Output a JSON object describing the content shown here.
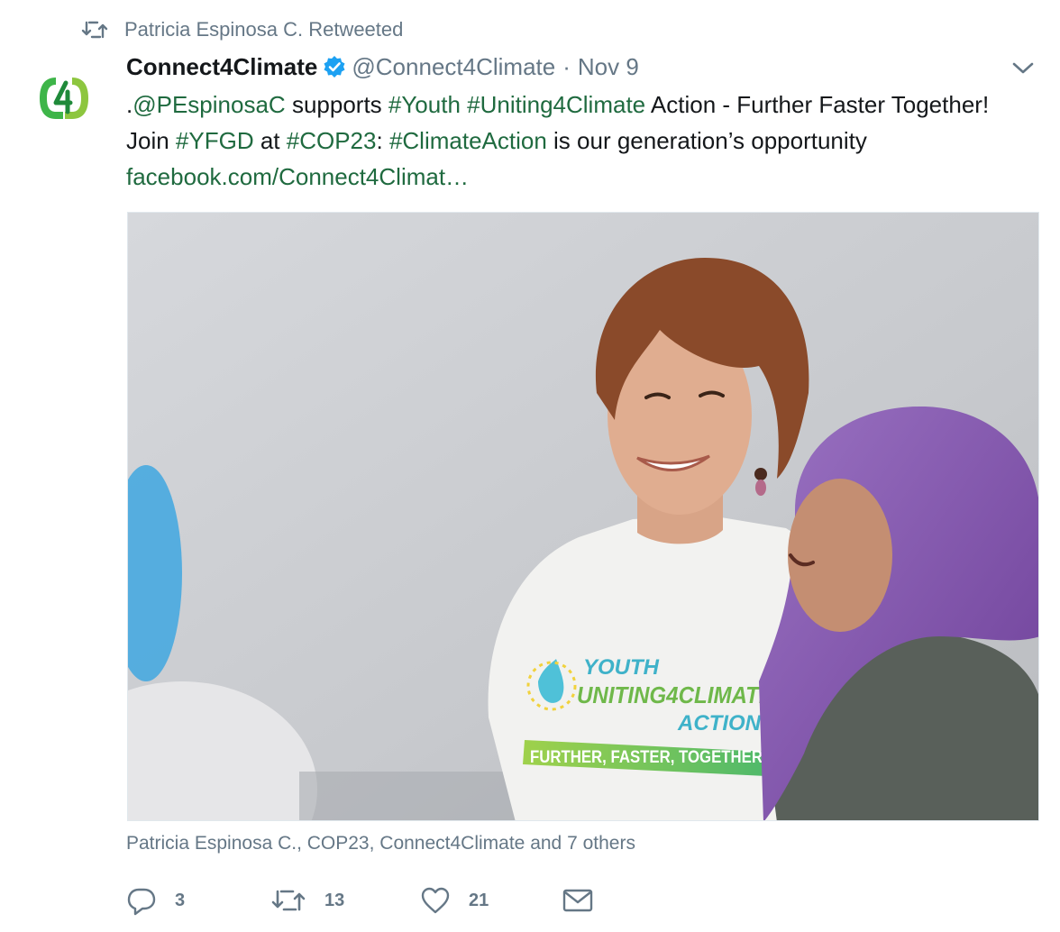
{
  "retweet_context": {
    "icon": "retweet-icon",
    "text": "Patricia Espinosa C. Retweeted"
  },
  "author": {
    "name": "Connect4Climate",
    "verified": true,
    "handle": "@Connect4Climate",
    "separator": "·",
    "date": "Nov 9",
    "avatar_icon": "connect4climate-logo",
    "brand_color": "#3eb549"
  },
  "tweet": {
    "segments": [
      {
        "text": ".",
        "link": false
      },
      {
        "text": "@PEspinosaC",
        "link": true
      },
      {
        "text": " supports ",
        "link": false
      },
      {
        "text": "#Youth",
        "link": true
      },
      {
        "text": " ",
        "link": false
      },
      {
        "text": "#Uniting4Climate",
        "link": true
      },
      {
        "text": " Action - Further Faster Together! Join ",
        "link": false
      },
      {
        "text": "#YFGD",
        "link": true
      },
      {
        "text": " at ",
        "link": false
      },
      {
        "text": "#COP23",
        "link": true
      },
      {
        "text": ": ",
        "link": false
      },
      {
        "text": "#ClimateAction",
        "link": true
      },
      {
        "text": " is our generation’s opportunity ",
        "link": false
      },
      {
        "text": "facebook.com/Connect4Climat…",
        "link": true
      }
    ],
    "link_color": "#1f6a3f"
  },
  "media": {
    "alt": "",
    "shirt_lines": [
      "YOUTH",
      "UNITING4CLIMATE",
      "ACTION",
      "FURTHER, FASTER, TOGETHER"
    ]
  },
  "tagged": "Patricia Espinosa C., COP23, Connect4Climate and 7 others",
  "actions": {
    "reply": {
      "icon": "reply-icon",
      "count": "3"
    },
    "retweet": {
      "icon": "retweet-icon",
      "count": "13"
    },
    "like": {
      "icon": "heart-icon",
      "count": "21"
    },
    "message": {
      "icon": "envelope-icon"
    }
  },
  "colors": {
    "text": "#14171a",
    "muted": "#657786",
    "verified": "#1da1f2"
  }
}
